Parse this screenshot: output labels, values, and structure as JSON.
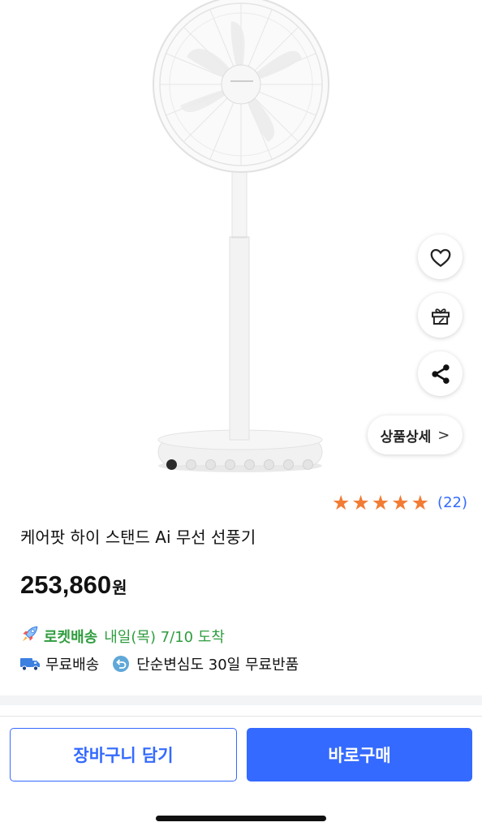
{
  "gallery": {
    "image_name": "stand-fan-product-image",
    "image_count": 8,
    "active_index": 0
  },
  "actions": {
    "wishlist_icon": "heart-icon",
    "gift_icon": "gift-rocket-icon",
    "share_icon": "share-icon",
    "detail_label": "상품상세",
    "detail_chevron": ">"
  },
  "rating": {
    "stars": 5,
    "count_text": "(22)",
    "star_color": "#f27c34"
  },
  "product": {
    "title": "케어팟 하이 스탠드 Ai 무선 선풍기",
    "price": "253,860",
    "currency": "원"
  },
  "delivery": {
    "rocket_icon": "rocket-icon",
    "rocket_label": "로켓배송",
    "arrival_text": "내일(목) 7/10 도착",
    "color": "#2f9d3f"
  },
  "benefits": [
    {
      "icon": "truck-icon",
      "label": "무료배송"
    },
    {
      "icon": "return-arrow-icon",
      "label": "단순변심도 30일 무료반품"
    }
  ],
  "bottom": {
    "cart_label": "장바구니 담기",
    "buy_label": "바로구매",
    "accent": "#346aff"
  }
}
